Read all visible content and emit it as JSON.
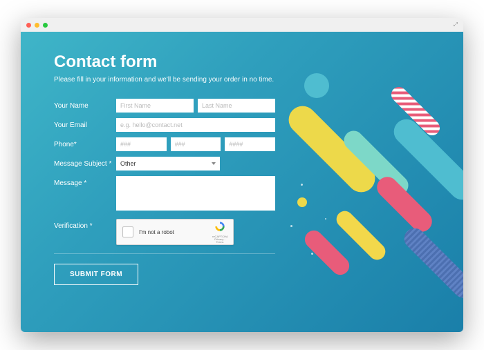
{
  "header": {
    "title": "Contact form",
    "subtitle": "Please fill in your information and we'll be sending your order in no time."
  },
  "form": {
    "name": {
      "label": "Your Name",
      "first_ph": "First Name",
      "last_ph": "Last Name"
    },
    "email": {
      "label": "Your Email",
      "ph": "e.g. hello@contact.net"
    },
    "phone": {
      "label": "Phone*",
      "p1": "###",
      "p2": "###",
      "p3": "####"
    },
    "subject": {
      "label": "Message Subject *",
      "selected": "Other"
    },
    "message": {
      "label": "Message *"
    },
    "verify": {
      "label": "Verification *",
      "text": "I'm not a robot",
      "brand": "reCAPTCHA",
      "priv": "Privacy - Terms"
    },
    "submit": "SUBMIT FORM"
  }
}
